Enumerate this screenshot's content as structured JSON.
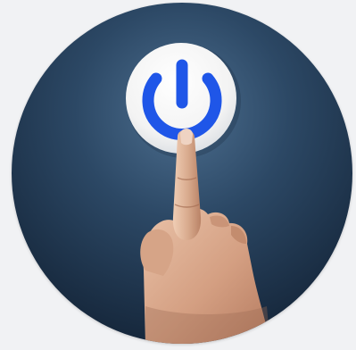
{
  "image": {
    "subject": "power-button-press",
    "icon": "power-icon",
    "colors": {
      "page_background": "#f1f2f4",
      "backdrop_light": "#4d6f90",
      "backdrop_dark": "#15263a",
      "button_face": "#f7f7f7",
      "power_symbol": "#1f56e8",
      "skin": "#d9aa8d"
    }
  }
}
